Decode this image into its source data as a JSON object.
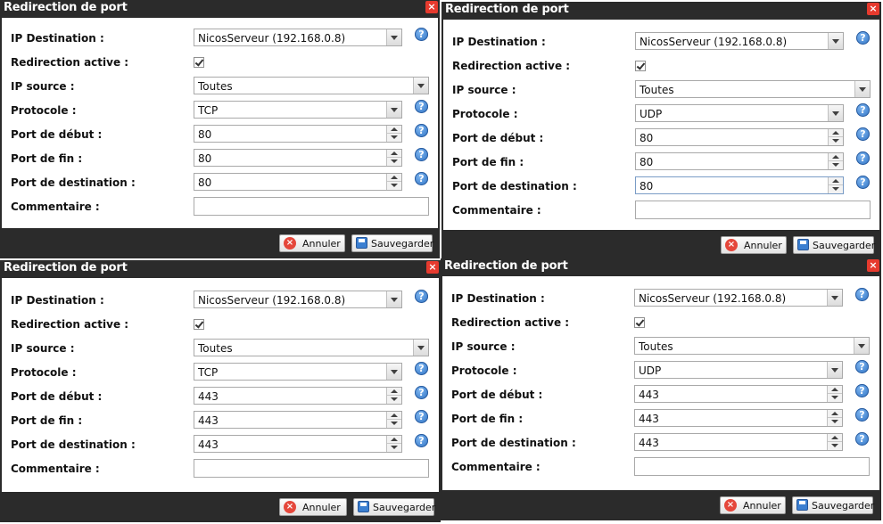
{
  "labels": {
    "ip_destination": "IP Destination :",
    "redirection_active": "Redirection active :",
    "ip_source": "IP source :",
    "protocole": "Protocole :",
    "port_debut": "Port de début :",
    "port_fin": "Port de fin :",
    "port_destination": "Port de destination :",
    "commentaire": "Commentaire :",
    "help": "?",
    "close": "×"
  },
  "buttons": {
    "cancel": "Annuler",
    "save": "Sauvegarder"
  },
  "dialogs": [
    {
      "title": "Redirection de port",
      "ip_destination": "NicosServeur (192.168.0.8)",
      "redirection_active": true,
      "ip_source": "Toutes",
      "protocole": "TCP",
      "port_debut": "80",
      "port_fin": "80",
      "port_destination": "80",
      "commentaire": ""
    },
    {
      "title": "Redirection de port",
      "ip_destination": "NicosServeur (192.168.0.8)",
      "redirection_active": true,
      "ip_source": "Toutes",
      "protocole": "UDP",
      "port_debut": "80",
      "port_fin": "80",
      "port_destination": "80",
      "commentaire": ""
    },
    {
      "title": "Redirection de port",
      "ip_destination": "NicosServeur (192.168.0.8)",
      "redirection_active": true,
      "ip_source": "Toutes",
      "protocole": "TCP",
      "port_debut": "443",
      "port_fin": "443",
      "port_destination": "443",
      "commentaire": ""
    },
    {
      "title": "Redirection de port",
      "ip_destination": "NicosServeur (192.168.0.8)",
      "redirection_active": true,
      "ip_source": "Toutes",
      "protocole": "UDP",
      "port_debut": "443",
      "port_fin": "443",
      "port_destination": "443",
      "commentaire": ""
    }
  ]
}
